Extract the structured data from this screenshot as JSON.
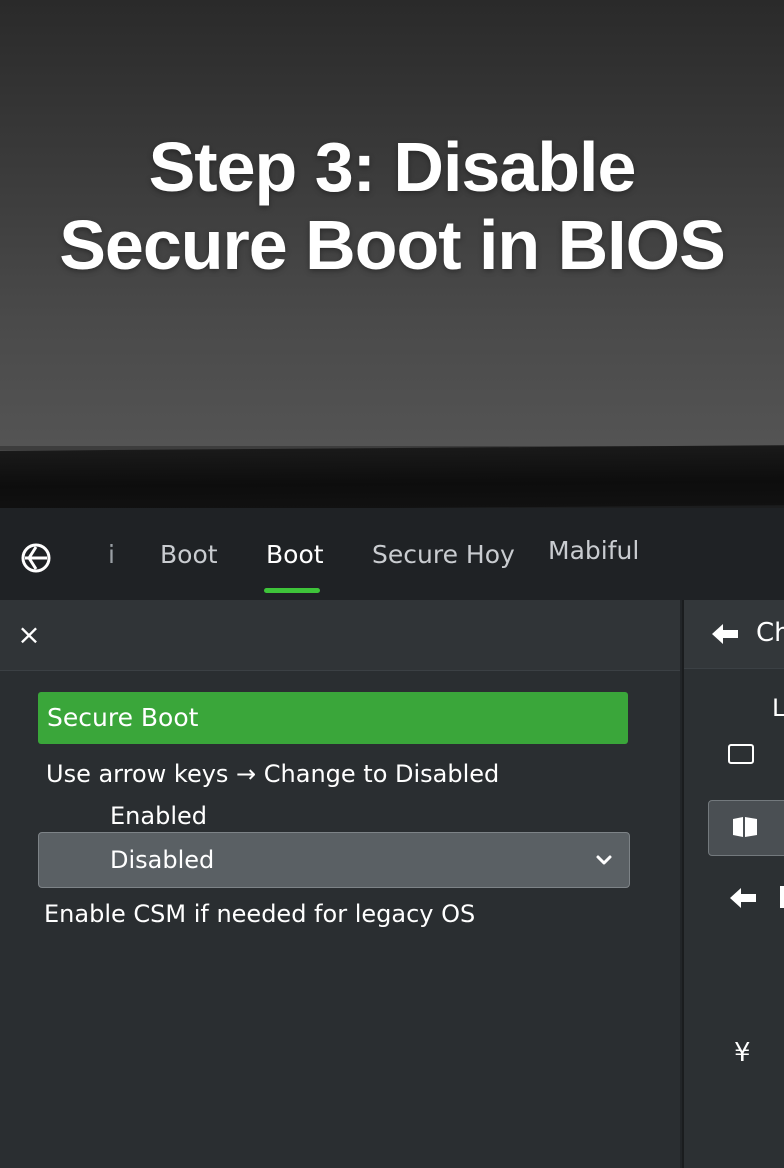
{
  "headline": {
    "line1": "Step 3: Disable",
    "line2": "Secure Boot in BIOS"
  },
  "nav": {
    "items": [
      {
        "label": "i"
      },
      {
        "label": "Boot"
      },
      {
        "label": "Boot"
      },
      {
        "label": "Secure Hoy"
      },
      {
        "label": "Mabiful"
      }
    ],
    "active_index": 2,
    "accent_color": "#3ec43a"
  },
  "main": {
    "close_icon": "×",
    "selected_item": "Secure Boot",
    "hint": "Use arrow keys → Change to Disabled",
    "option_enabled": "Enabled",
    "dropdown_value": "Disabled",
    "csm_note": "Enable CSM if needed for legacy OS",
    "highlight_color": "#3aa63a"
  },
  "side": {
    "header_label": "Ch",
    "letter": "L",
    "yen_icon": "¥"
  },
  "icons": {
    "logo": "bios-logo-icon",
    "close": "close-icon",
    "chevron": "chevron-down-icon",
    "back": "back-arrow-icon",
    "tablet": "tablet-icon",
    "book": "book-icon",
    "yen": "yen-icon"
  }
}
